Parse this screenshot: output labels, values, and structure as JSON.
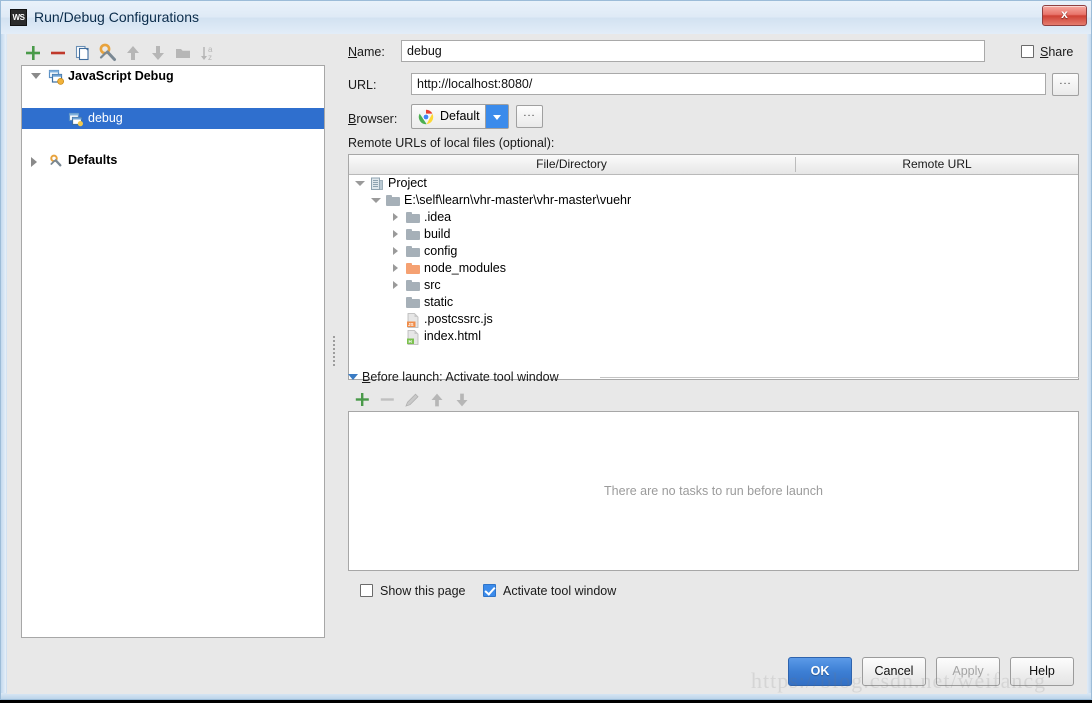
{
  "window": {
    "title": "Run/Debug Configurations",
    "app_icon_text": "WS",
    "close_label": "x"
  },
  "toolbar": {
    "items": [
      {
        "name": "add-configuration-button",
        "icon": "plus-icon",
        "tooltip": "Add New Configuration"
      },
      {
        "name": "remove-configuration-button",
        "icon": "minus-icon",
        "tooltip": "Remove Configuration"
      },
      {
        "name": "copy-configuration-button",
        "icon": "copy-icon",
        "tooltip": "Copy Configuration"
      },
      {
        "name": "edit-defaults-button",
        "icon": "wrench-icon",
        "tooltip": "Edit defaults"
      },
      {
        "name": "move-up-button",
        "icon": "arrow-up-icon",
        "tooltip": "Move Up"
      },
      {
        "name": "move-down-button",
        "icon": "arrow-down-icon",
        "tooltip": "Move Down"
      },
      {
        "name": "create-folder-button",
        "icon": "folder-icon",
        "tooltip": "Create New Folder"
      },
      {
        "name": "sort-configurations-button",
        "icon": "sort-az-icon",
        "tooltip": "Sort Configurations"
      }
    ]
  },
  "config_tree": {
    "nodes": [
      {
        "label": "JavaScript Debug",
        "level": 0,
        "expanded": true,
        "selected": false,
        "bold": true,
        "icon": "js-debug-icon"
      },
      {
        "label": "debug",
        "level": 1,
        "expanded": null,
        "selected": true,
        "bold": false,
        "icon": "js-debug-config-icon"
      },
      {
        "label": "Defaults",
        "level": 0,
        "expanded": false,
        "selected": false,
        "bold": true,
        "icon": "wrench-icon"
      }
    ]
  },
  "form": {
    "name_label": "Name:",
    "name_mnemonic": "N",
    "name_value": "debug",
    "share_label": "Share",
    "share_mnemonic": "S",
    "share_checked": false,
    "url_label": "URL:",
    "url_value": "http://localhost:8080/",
    "url_browse_label": "...",
    "browser_label": "Browser:",
    "browser_mnemonic": "B",
    "browser_value": "Default",
    "browser_icon": "chrome-icon",
    "browser_config_label": "..."
  },
  "remote_urls": {
    "section_label": "Remote URLs of local files (optional):",
    "columns": [
      "File/Directory",
      "Remote URL"
    ],
    "rows": [
      {
        "label": "Project",
        "level": 0,
        "expanded": true,
        "icon": "project-icon",
        "remote_url": ""
      },
      {
        "label": "E:\\self\\learn\\vhr-master\\vhr-master\\vuehr",
        "level": 1,
        "expanded": true,
        "icon": "folder-icon",
        "remote_url": ""
      },
      {
        "label": ".idea",
        "level": 2,
        "expanded": false,
        "icon": "folder-icon",
        "remote_url": ""
      },
      {
        "label": "build",
        "level": 2,
        "expanded": false,
        "icon": "folder-icon",
        "remote_url": ""
      },
      {
        "label": "config",
        "level": 2,
        "expanded": false,
        "icon": "folder-icon",
        "remote_url": ""
      },
      {
        "label": "node_modules",
        "level": 2,
        "expanded": false,
        "icon": "folder-orange-icon",
        "remote_url": ""
      },
      {
        "label": "src",
        "level": 2,
        "expanded": false,
        "icon": "folder-icon",
        "remote_url": ""
      },
      {
        "label": "static",
        "level": 2,
        "expanded": null,
        "icon": "folder-icon",
        "remote_url": ""
      },
      {
        "label": ".postcssrc.js",
        "level": 2,
        "expanded": null,
        "icon": "js-file-icon",
        "remote_url": ""
      },
      {
        "label": "index.html",
        "level": 2,
        "expanded": null,
        "icon": "html-file-icon",
        "remote_url": ""
      }
    ]
  },
  "before_launch": {
    "title": "Before launch: Activate tool window",
    "title_mnemonic": "B",
    "expanded": true,
    "toolbar": [
      {
        "name": "add-task-button",
        "icon": "plus-icon",
        "enabled": true
      },
      {
        "name": "remove-task-button",
        "icon": "minus-icon",
        "enabled": false
      },
      {
        "name": "edit-task-button",
        "icon": "pencil-icon",
        "enabled": false
      },
      {
        "name": "task-move-up-button",
        "icon": "arrow-up-icon",
        "enabled": false
      },
      {
        "name": "task-move-down-button",
        "icon": "arrow-down-icon",
        "enabled": false
      }
    ],
    "empty_text": "There are no tasks to run before launch",
    "show_page_label": "Show this page",
    "show_page_checked": false,
    "activate_tool_window_label": "Activate tool window",
    "activate_tool_window_checked": true
  },
  "footer": {
    "ok_label": "OK",
    "cancel_label": "Cancel",
    "apply_label": "Apply",
    "apply_enabled": false,
    "help_label": "Help"
  },
  "watermark": {
    "text": "https://blog.csdn.net/weifancg"
  },
  "colors": {
    "selection_blue": "#2f6fce",
    "accent_blue": "#3b8beb",
    "primary_button": "#3d7fd4",
    "dialog_bg": "#e8e8e8",
    "panel_bg": "#ffffff",
    "folder_gray": "#a6b0b8",
    "folder_orange": "#f5a172"
  }
}
